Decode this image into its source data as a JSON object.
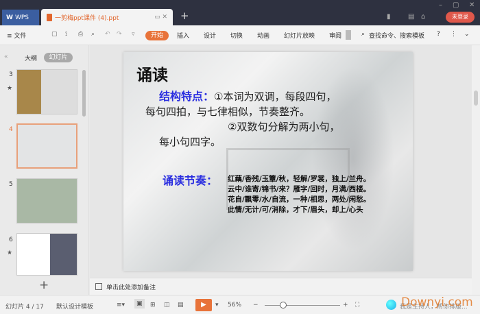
{
  "titlebar": {
    "wps_label": "WPS",
    "doc_title": "一剪梅ppt课件 (4).ppt",
    "new_tab": "+",
    "login": "未登录"
  },
  "toolbar": {
    "menu": "≡ 文件",
    "start": "开始",
    "tabs": [
      "插入",
      "设计",
      "切换",
      "动画",
      "幻灯片放映",
      "审阅"
    ],
    "search": "查找命令、搜索模板",
    "help": "?"
  },
  "left": {
    "tab_outline": "大纲",
    "tab_slides": "幻灯片",
    "slides": [
      "3",
      "4",
      "5",
      "6"
    ],
    "add": "+"
  },
  "slide": {
    "title": "诵读",
    "structure_label": "结构特点：",
    "structure_text": [
      "①本词为双调，每段四句，",
      "每句四拍，与七律相似，节奏整齐。",
      "②双数句分解为两小句，",
      "每小句四字。"
    ],
    "rhythm_label": "诵读节奏：",
    "rhythm_lines": [
      "红藕/香残/玉簟/秋，轻解/罗裳，独上/兰舟。",
      "云中/谁寄/锦书/来？雁字/回时，月满/西楼。",
      "花自/飘零/水/自流，一种/相思，两处/闲愁。",
      "此情/无计/可/消除，才下/眉头，却上/心头"
    ]
  },
  "notes": {
    "placeholder": "单击此处添加备注"
  },
  "status": {
    "slide_count": "幻灯片 4 / 17",
    "template": "默认设计模板",
    "zoom": "56%",
    "assistant": "我是主持人，帮你排版...",
    "watermark": "Downyi.com"
  }
}
